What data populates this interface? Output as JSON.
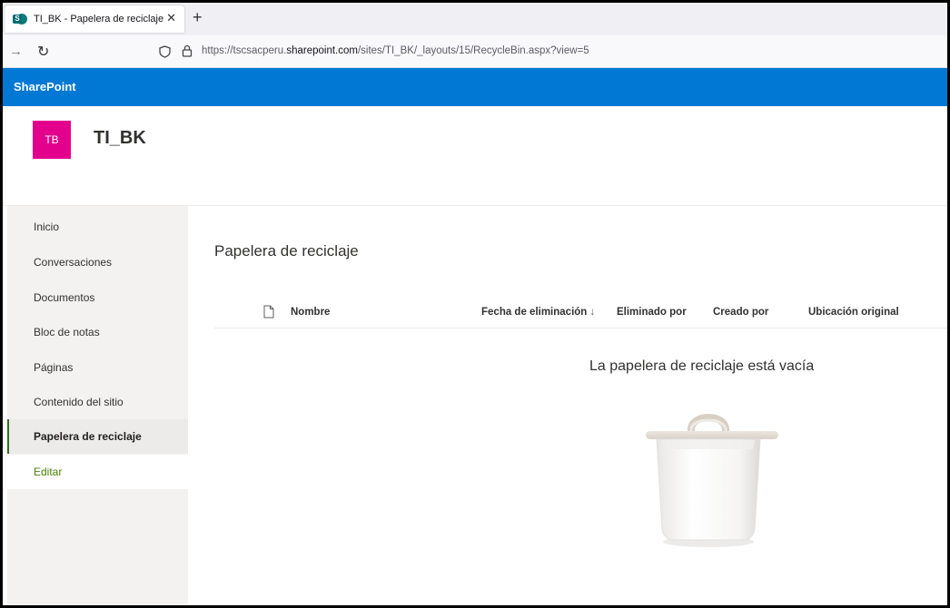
{
  "browser": {
    "tab_title": "TI_BK - Papelera de reciclaje",
    "tab_close": "✕",
    "new_tab": "+",
    "url_prefix": "https://tscsacperu.",
    "url_domain": "sharepoint.com",
    "url_suffix": "/sites/TI_BK/_layouts/15/RecycleBin.aspx?view=5"
  },
  "suite": {
    "title": "SharePoint"
  },
  "site": {
    "logo_initials": "TB",
    "title": "TI_BK"
  },
  "nav": {
    "items": [
      {
        "label": "Inicio"
      },
      {
        "label": "Conversaciones"
      },
      {
        "label": "Documentos"
      },
      {
        "label": "Bloc de notas"
      },
      {
        "label": "Páginas"
      },
      {
        "label": "Contenido del sitio"
      },
      {
        "label": "Papelera de reciclaje",
        "selected": true
      },
      {
        "label": "Editar"
      }
    ]
  },
  "main": {
    "title": "Papelera de reciclaje",
    "columns": {
      "name": "Nombre",
      "deleted_date": "Fecha de eliminación",
      "sort_arrow": "↓",
      "deleted_by": "Eliminado por",
      "created_by": "Creado por",
      "original_location": "Ubicación original"
    },
    "empty_message": "La papelera de reciclaje está vacía"
  },
  "colors": {
    "suite_bar": "#0078d4",
    "site_logo": "#e3008c",
    "nav_selected_border": "#2e6e1c",
    "edit_link": "#498205"
  },
  "icons": [
    "sharepoint-favicon",
    "forward-arrow-icon",
    "reload-icon",
    "shield-icon",
    "lock-icon",
    "document-icon",
    "empty-bin-illustration"
  ]
}
